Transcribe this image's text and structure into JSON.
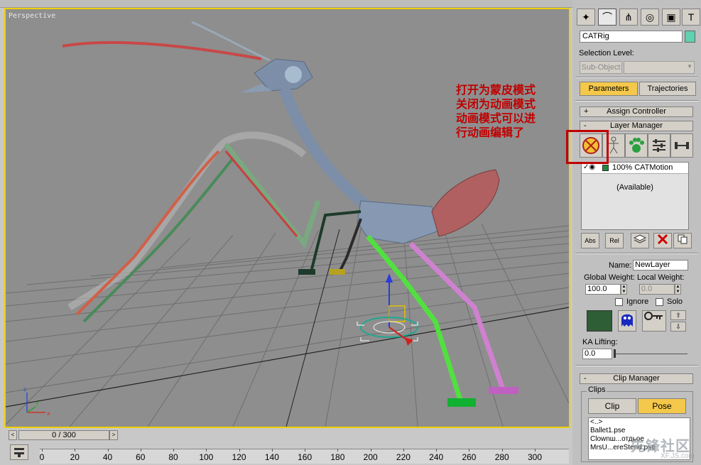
{
  "viewport": {
    "label": "Perspective",
    "annotation": "打开为蒙皮模式\n关闭为动画模式\n动画模式可以进\n行动画编辑了"
  },
  "timeline": {
    "frame_display": "0 / 300",
    "ticks": [
      "0",
      "20",
      "40",
      "60",
      "80",
      "100",
      "120",
      "140",
      "160",
      "180",
      "200",
      "220",
      "240",
      "260",
      "280",
      "300"
    ]
  },
  "panel": {
    "object_name": "CATRig",
    "object_color": "#5fd0b0",
    "selection_level_label": "Selection Level:",
    "sub_object_label": "Sub-Object",
    "tabs": {
      "parameters": "Parameters",
      "trajectories": "Trajectories"
    },
    "rollouts": {
      "assign_controller": "Assign Controller",
      "layer_manager": "Layer Manager",
      "clip_manager": "Clip Manager"
    },
    "layer_list": {
      "row_label": "100% CATMotion",
      "available": "(Available)"
    },
    "layer_buttons": {
      "abs": "Abs",
      "rel": "Rel"
    },
    "layer_props": {
      "name_label": "Name:",
      "name_value": "NewLayer",
      "global_weight_label": "Global Weight:",
      "local_weight_label": "Local Weight:",
      "global_weight_value": "100.0",
      "local_weight_value": "0.0",
      "ignore_label": "Ignore",
      "solo_label": "Solo",
      "layer_color": "#2e5e35",
      "ka_lifting_label": "KA Lifting:",
      "ka_lifting_value": "0.0"
    },
    "clip_manager": {
      "group_label": "Clips",
      "clip_button": "Clip",
      "pose_button": "Pose",
      "items": [
        "<..>",
        "Ballet1.pse",
        "Clownш...отдьое",
        "MrsU...ereStend.pse"
      ]
    }
  },
  "watermark": {
    "text": "先锋社区",
    "sub": "XF.JS.com"
  }
}
